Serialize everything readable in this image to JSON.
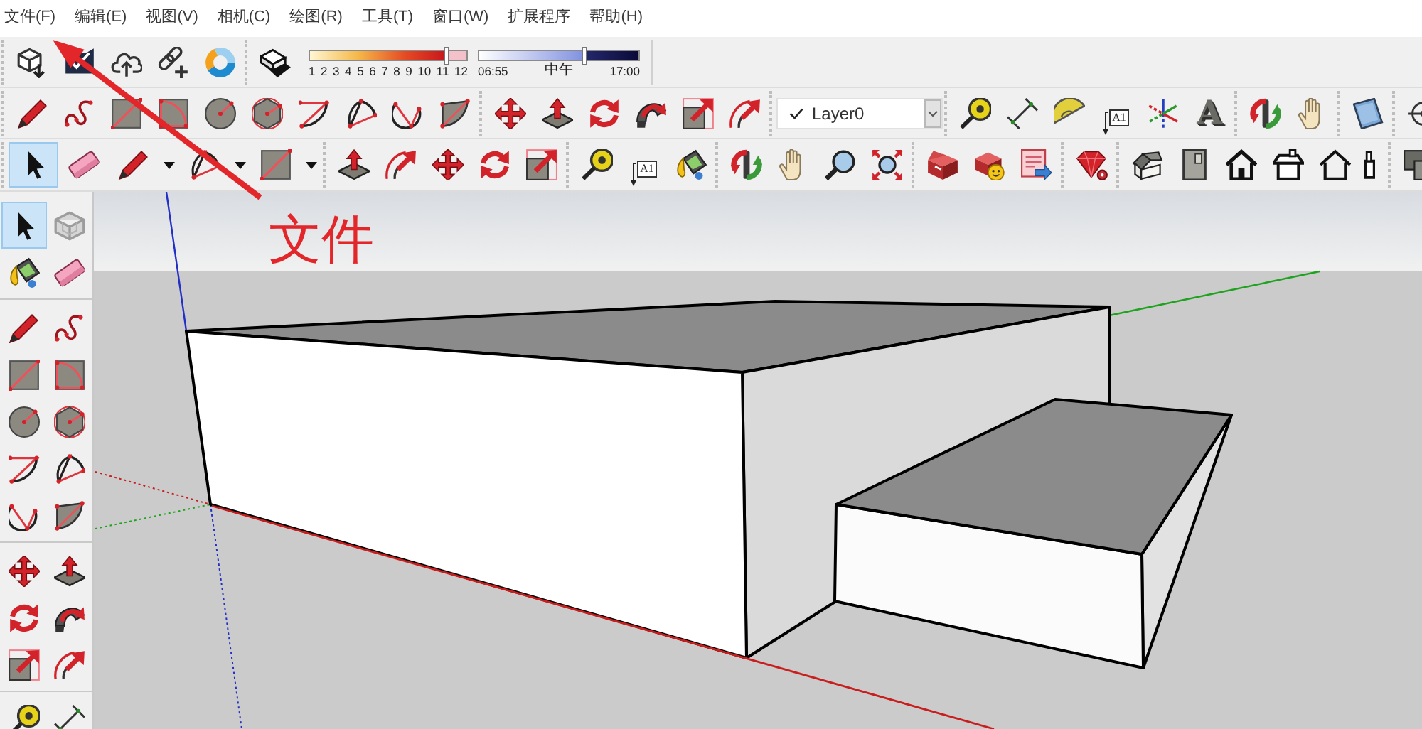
{
  "menu_bar": [
    "文件(F)",
    "编辑(E)",
    "视图(V)",
    "相机(C)",
    "绘图(R)",
    "工具(T)",
    "窗口(W)",
    "扩展程序",
    "帮助(H)"
  ],
  "toolbar_rows": [
    {
      "groups": [
        {
          "tools": [
            {
              "kind": "download",
              "selected": false
            },
            {
              "kind": "share",
              "selected": false
            },
            {
              "kind": "upload",
              "selected": false
            },
            {
              "kind": "link",
              "selected": false
            },
            {
              "kind": "ring",
              "selected": false
            }
          ]
        },
        {
          "tools": [
            {
              "kind": "shadow",
              "selected": false
            }
          ],
          "sliders": [
            {
              "kind": "month",
              "level": 0.875,
              "labels": [
                "1",
                "2",
                "3",
                "4",
                "5",
                "6",
                "7",
                "8",
                "9",
                "10",
                "11",
                "12"
              ]
            },
            {
              "kind": "time",
              "level": 0.66,
              "labels": [
                "06:55",
                "中午",
                "17:00"
              ]
            }
          ]
        }
      ]
    },
    {
      "groups": [
        {
          "tools": [
            {
              "kind": "pencil",
              "selected": false
            },
            {
              "kind": "squiggle",
              "selected": false
            },
            {
              "kind": "rectangle",
              "selected": false
            },
            {
              "kind": "rotrect",
              "selected": false
            },
            {
              "kind": "circle",
              "selected": false
            },
            {
              "kind": "polygon",
              "selected": false
            },
            {
              "kind": "arc",
              "selected": false
            },
            {
              "kind": "sector",
              "selected": false
            },
            {
              "kind": "chord",
              "selected": false
            },
            {
              "kind": "pie",
              "selected": false
            }
          ]
        },
        {
          "tools": [
            {
              "kind": "move",
              "selected": false
            },
            {
              "kind": "pushpull",
              "selected": false
            },
            {
              "kind": "rotate",
              "selected": false
            },
            {
              "kind": "follow",
              "selected": false
            },
            {
              "kind": "scale",
              "selected": false
            },
            {
              "kind": "offset",
              "selected": false
            }
          ]
        },
        {
          "dropdown": {
            "value": "Layer0"
          }
        },
        {
          "tools": [
            {
              "kind": "tape",
              "selected": false
            },
            {
              "kind": "dimension",
              "selected": false
            },
            {
              "kind": "protractor",
              "selected": false
            },
            {
              "kind": "label",
              "label": "A1",
              "selected": false
            },
            {
              "kind": "axes",
              "selected": false
            },
            {
              "kind": "solidtext",
              "label": "A",
              "selected": false
            }
          ]
        },
        {
          "tools": [
            {
              "kind": "orbit",
              "selected": false
            },
            {
              "kind": "hand",
              "selected": false
            }
          ]
        },
        {
          "tools": [
            {
              "kind": "panel",
              "selected": false
            }
          ]
        },
        {
          "tools": [
            {
              "kind": "crosshair",
              "selected": false
            }
          ]
        }
      ]
    },
    {
      "groups": [
        {
          "tools": [
            {
              "kind": "select",
              "selected": true
            },
            {
              "kind": "eraser",
              "selected": false
            },
            {
              "kind": "pencil",
              "selected": false
            },
            {
              "kind": "caret",
              "selected": false
            },
            {
              "kind": "sector",
              "selected": false
            },
            {
              "kind": "caret",
              "selected": false
            },
            {
              "kind": "rectangle",
              "selected": false
            },
            {
              "kind": "caret",
              "selected": false
            }
          ]
        },
        {
          "tools": [
            {
              "kind": "pushpull",
              "selected": false
            },
            {
              "kind": "offset",
              "selected": false
            },
            {
              "kind": "move",
              "selected": false
            },
            {
              "kind": "rotate",
              "selected": false
            },
            {
              "kind": "scale",
              "selected": false
            }
          ]
        },
        {
          "tools": [
            {
              "kind": "tape",
              "selected": false
            },
            {
              "kind": "label",
              "label": "A1",
              "selected": false
            },
            {
              "kind": "paint",
              "selected": false
            }
          ]
        },
        {
          "tools": [
            {
              "kind": "orbit",
              "selected": false
            },
            {
              "kind": "hand",
              "selected": false
            },
            {
              "kind": "magnifier",
              "selected": false
            },
            {
              "kind": "extents",
              "selected": false
            }
          ]
        },
        {
          "tools": [
            {
              "kind": "warehouse",
              "selected": false
            },
            {
              "kind": "extensions",
              "selected": false
            },
            {
              "kind": "document",
              "selected": false
            }
          ]
        },
        {
          "tools": [
            {
              "kind": "gem",
              "selected": false
            }
          ]
        },
        {
          "tools": [
            {
              "kind": "iso",
              "selected": false
            },
            {
              "kind": "cabinet",
              "selected": false
            },
            {
              "kind": "front",
              "selected": false
            },
            {
              "kind": "right",
              "selected": false
            },
            {
              "kind": "back",
              "selected": false
            },
            {
              "kind": "left",
              "selected": false
            }
          ]
        },
        {
          "tools": [
            {
              "kind": "stacked",
              "selected": false
            }
          ]
        }
      ]
    }
  ],
  "left_toolbar": {
    "groups": [
      {
        "tools": [
          {
            "kind": "select",
            "selected": true
          },
          {
            "kind": "component",
            "selected": false
          },
          {
            "kind": "paint",
            "selected": false
          },
          {
            "kind": "eraser",
            "selected": false
          }
        ]
      },
      {
        "tools": [
          {
            "kind": "pencil",
            "selected": false
          },
          {
            "kind": "squiggle",
            "selected": false
          },
          {
            "kind": "rectangle",
            "selected": false
          },
          {
            "kind": "rotrect",
            "selected": false
          },
          {
            "kind": "circle",
            "selected": false
          },
          {
            "kind": "polygon",
            "selected": false
          },
          {
            "kind": "arc",
            "selected": false
          },
          {
            "kind": "sector",
            "selected": false
          },
          {
            "kind": "chord",
            "selected": false
          },
          {
            "kind": "pie",
            "selected": false
          }
        ]
      },
      {
        "tools": [
          {
            "kind": "move",
            "selected": false
          },
          {
            "kind": "pushpull",
            "selected": false
          },
          {
            "kind": "rotate",
            "selected": false
          },
          {
            "kind": "follow",
            "selected": false
          },
          {
            "kind": "scale",
            "selected": false
          },
          {
            "kind": "offset",
            "selected": false
          }
        ]
      },
      {
        "tools": [
          {
            "kind": "tape",
            "selected": false
          },
          {
            "kind": "dimension",
            "selected": false
          }
        ]
      }
    ]
  },
  "annotation": {
    "text": "文件"
  }
}
